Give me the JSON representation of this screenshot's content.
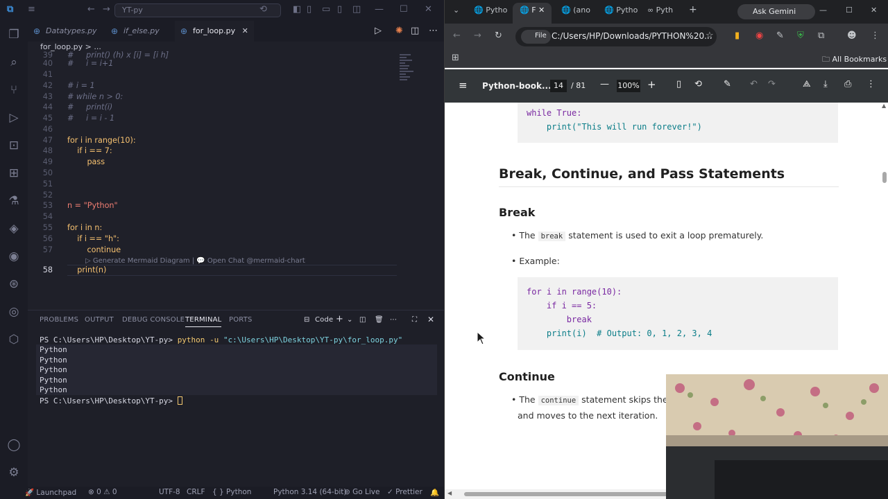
{
  "vscode": {
    "search_text": "YT-py",
    "tabs": [
      {
        "label": "Datatypes.py"
      },
      {
        "label": "if_else.py"
      },
      {
        "label": "for_loop.py"
      }
    ],
    "breadcrumb": "for_loop.py > ...",
    "editor_lines": [
      {
        "n": "39",
        "t": "#     print() (h) x [i] = [i h]"
      },
      {
        "n": "40",
        "t": "#     i = i+1"
      },
      {
        "n": "41",
        "t": ""
      },
      {
        "n": "42",
        "t": "# i = 1"
      },
      {
        "n": "43",
        "t": "# while n > 0:"
      },
      {
        "n": "44",
        "t": "#     print(i)"
      },
      {
        "n": "45",
        "t": "#     i = i - 1"
      },
      {
        "n": "46",
        "t": ""
      },
      {
        "n": "47",
        "t": "for i in range(10):"
      },
      {
        "n": "48",
        "t": "    if i == 7:"
      },
      {
        "n": "49",
        "t": "        pass"
      },
      {
        "n": "50",
        "t": ""
      },
      {
        "n": "51",
        "t": ""
      },
      {
        "n": "52",
        "t": ""
      },
      {
        "n": "53",
        "t": "n = \"Python\""
      },
      {
        "n": "54",
        "t": ""
      },
      {
        "n": "55",
        "t": "for i in n:"
      },
      {
        "n": "56",
        "t": "    if i == \"h\":"
      },
      {
        "n": "57",
        "t": "        continue"
      },
      {
        "n": "58",
        "t": "    print(n)"
      }
    ],
    "codelens": "▷ Generate Mermaid Diagram | 💬 Open Chat @mermaid-chart",
    "panel_tabs": [
      "PROBLEMS",
      "OUTPUT",
      "DEBUG CONSOLE",
      "TERMINAL",
      "PORTS"
    ],
    "panel_code_label": "Code",
    "terminal": {
      "prompt": "PS C:\\Users\\HP\\Desktop\\YT-py>",
      "command": "python",
      "flag": "-u",
      "arg": "\"c:\\Users\\HP\\Desktop\\YT-py\\for_loop.py\"",
      "output": [
        "Python",
        "Python",
        "Python",
        "Python",
        "Python"
      ]
    },
    "status": {
      "launchpad": "Launchpad",
      "errors": "0",
      "warnings": "0",
      "encoding": "UTF-8",
      "eol": "CRLF",
      "language": "Python",
      "interpreter": "Python 3.14 (64-bit)",
      "golive": "Go Live",
      "prettier": "Prettier"
    }
  },
  "chrome": {
    "tabs": [
      "Pytho",
      "F",
      "(ano",
      "Pytho",
      "Pyth"
    ],
    "gemini_label": "Ask Gemini",
    "file_chip": "File",
    "url": "C:/Users/HP/Downloads/PYTHON%20...",
    "bookmarks_label": "All Bookmarks",
    "pdf": {
      "title": "Python-book....",
      "page": "14",
      "total_pages": "/ 81",
      "zoom": "100%"
    },
    "content": {
      "code1": [
        "while True:",
        "    print(\"This will run forever!\")"
      ],
      "h2": "Break, Continue, and Pass Statements",
      "h3_break": "Break",
      "break_bullet_pre": "The",
      "break_code": "break",
      "break_bullet_post": "statement is used to exit a loop prematurely.",
      "example_label": "Example:",
      "code2": [
        "for i in range(10):",
        "    if i == 5:",
        "        break",
        "    print(i)  # Output: 0, 1, 2, 3, 4"
      ],
      "h3_continue": "Continue",
      "continue_pre": "The",
      "continue_code": "continue",
      "continue_post": "statement skips the re",
      "continue_line2": "and moves to the next iteration."
    }
  }
}
